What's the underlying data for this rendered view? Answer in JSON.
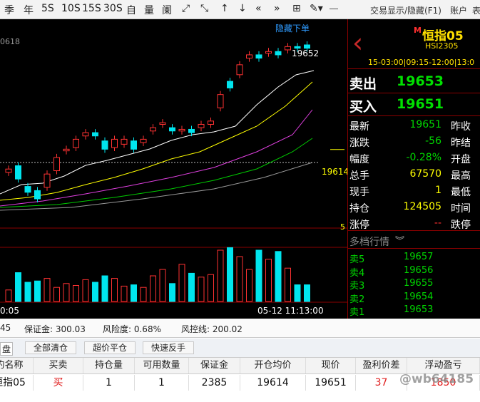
{
  "toolbar": {
    "buttons": [
      "季",
      "年",
      "5S",
      "10S",
      "15S",
      "30S",
      "自",
      "量",
      "阑",
      "⤢",
      "⤡",
      "↑",
      "↓",
      "«",
      "»",
      "⊞",
      "✎▾"
    ],
    "display_toggle": "交易显示/隐藏(F1)",
    "account": "账户",
    "more": "表"
  },
  "chart": {
    "hide_order_link": "隐藏下单",
    "top_left_value": "0618",
    "peak_label": "19652",
    "price_line_label": "19614",
    "right_scale_label": "5",
    "time_left": "0:05",
    "time_right": "05-12 11:13:00"
  },
  "chart_data": {
    "type": "candlestick",
    "last_price": 19652,
    "ref_price": 19614,
    "candles_oc": [
      [
        19602,
        19606
      ],
      [
        19610,
        19594
      ],
      [
        19585,
        19578
      ],
      [
        19580,
        19570
      ],
      [
        19584,
        19600
      ],
      [
        19604,
        19620
      ],
      [
        19628,
        19630
      ],
      [
        19632,
        19642
      ],
      [
        19646,
        19650
      ],
      [
        19650,
        19646
      ],
      [
        19640,
        19630
      ],
      [
        19632,
        19642
      ],
      [
        19636,
        19642
      ],
      [
        19640,
        19630
      ],
      [
        19638,
        19642
      ],
      [
        19652,
        19656
      ],
      [
        19660,
        19662
      ],
      [
        19656,
        19652
      ],
      [
        19652,
        19654
      ],
      [
        19654,
        19650
      ],
      [
        19656,
        19660
      ],
      [
        19660,
        19664
      ],
      [
        19680,
        19696
      ],
      [
        19712,
        19704
      ],
      [
        19720,
        19732
      ],
      [
        19740,
        19744
      ],
      [
        19744,
        19740
      ],
      [
        19746,
        19748
      ],
      [
        19748,
        19744
      ],
      [
        19750,
        19754
      ],
      [
        19754,
        19752
      ],
      [
        19756,
        19752
      ]
    ],
    "volumes": [
      18,
      45,
      30,
      32,
      36,
      22,
      28,
      25,
      34,
      30,
      40,
      36,
      24,
      26,
      22,
      40,
      50,
      28,
      58,
      44,
      38,
      42,
      80,
      84,
      70,
      50,
      80,
      66,
      78,
      52,
      26,
      26
    ]
  },
  "panel": {
    "badge": "M",
    "name": "恒指05",
    "code": "HSI2305",
    "session": "15-03:00|09:15-12:00|13:0",
    "sell_label": "卖出",
    "sell_price": "19653",
    "buy_label": "买入",
    "buy_price": "19651",
    "stats": [
      {
        "label": "最新",
        "value": "19651",
        "right": "昨收",
        "color": "#00d800"
      },
      {
        "label": "涨跌",
        "value": "-56",
        "right": "昨结",
        "color": "#00d800"
      },
      {
        "label": "幅度",
        "value": "-0.28%",
        "right": "开盘",
        "color": "#00d800"
      },
      {
        "label": "总手",
        "value": "67570",
        "right": "最高",
        "color": "#ffff00"
      },
      {
        "label": "现手",
        "value": "1",
        "right": "最低",
        "color": "#ffff00"
      },
      {
        "label": "持仓",
        "value": "124505",
        "right": "时间",
        "color": "#ffff00"
      },
      {
        "label": "涨停",
        "value": "--",
        "right": "跌停",
        "color": "#ff3030"
      }
    ],
    "depth_title": "多档行情",
    "depth": [
      {
        "label": "卖5",
        "price": "19657"
      },
      {
        "label": "卖4",
        "price": "19656"
      },
      {
        "label": "卖3",
        "price": "19655"
      },
      {
        "label": "卖2",
        "price": "19654"
      },
      {
        "label": "卖1",
        "price": "19653"
      }
    ]
  },
  "account": {
    "left_fragment": "45",
    "margin": "保证金: 300.03",
    "risk": "风险度: 0.68%",
    "control": "风控线: 200.02"
  },
  "actions": {
    "tab_fragment": "盘",
    "close_all": "全部清仓",
    "over_price": "超价平仓",
    "reverse": "快速反手"
  },
  "table": {
    "headers": [
      "约名称",
      "买卖",
      "持仓量",
      "可用数量",
      "保证金",
      "开仓均价",
      "现价",
      "盈利价差",
      "浮动盈亏"
    ],
    "row": [
      "恒指05",
      "买",
      "1",
      "1",
      "2385",
      "19614",
      "19651",
      "37",
      "1850"
    ]
  },
  "watermark": "@wb64185",
  "colors": {
    "up": "#ff3232",
    "down": "#00e5ee",
    "price_green": "#00d800",
    "yellow": "#ffff00"
  }
}
